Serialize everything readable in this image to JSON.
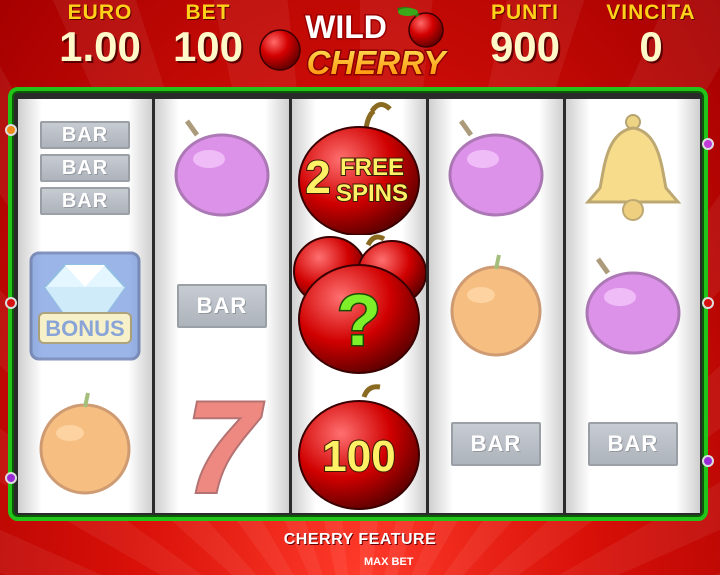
{
  "hud": {
    "euro": {
      "label": "EURO",
      "value": "1.00"
    },
    "bet": {
      "label": "BET",
      "value": "100"
    },
    "punti": {
      "label": "PUNTI",
      "value": "900"
    },
    "vincita": {
      "label": "VINCITA",
      "value": "0"
    }
  },
  "logo": {
    "line1": "WILD",
    "line2": "CHERRY"
  },
  "reels": {
    "reel1": [
      {
        "symbol": "bar-triple",
        "labels": [
          "BAR",
          "BAR",
          "BAR"
        ]
      },
      {
        "symbol": "bonus-diamond",
        "label": "BONUS"
      },
      {
        "symbol": "orange"
      }
    ],
    "reel2": [
      {
        "symbol": "plum"
      },
      {
        "symbol": "bar",
        "label": "BAR"
      },
      {
        "symbol": "seven",
        "label": "7"
      }
    ],
    "reel3": [
      {
        "symbol": "cherry-free-spins",
        "count": "2",
        "text1": "FREE",
        "text2": "SPINS"
      },
      {
        "symbol": "cherry-mystery",
        "label": "?"
      },
      {
        "symbol": "cherry-value",
        "label": "100"
      }
    ],
    "reel4": [
      {
        "symbol": "plum"
      },
      {
        "symbol": "orange"
      },
      {
        "symbol": "bar",
        "label": "BAR"
      }
    ],
    "reel5": [
      {
        "symbol": "bell"
      },
      {
        "symbol": "plum"
      },
      {
        "symbol": "bar",
        "label": "BAR"
      }
    ]
  },
  "footer": {
    "title": "CHERRY FEATURE",
    "subtitle": "MAX BET"
  },
  "colors": {
    "frame": "#22c41a",
    "label": "#ffd11a",
    "background": "#d81008"
  }
}
